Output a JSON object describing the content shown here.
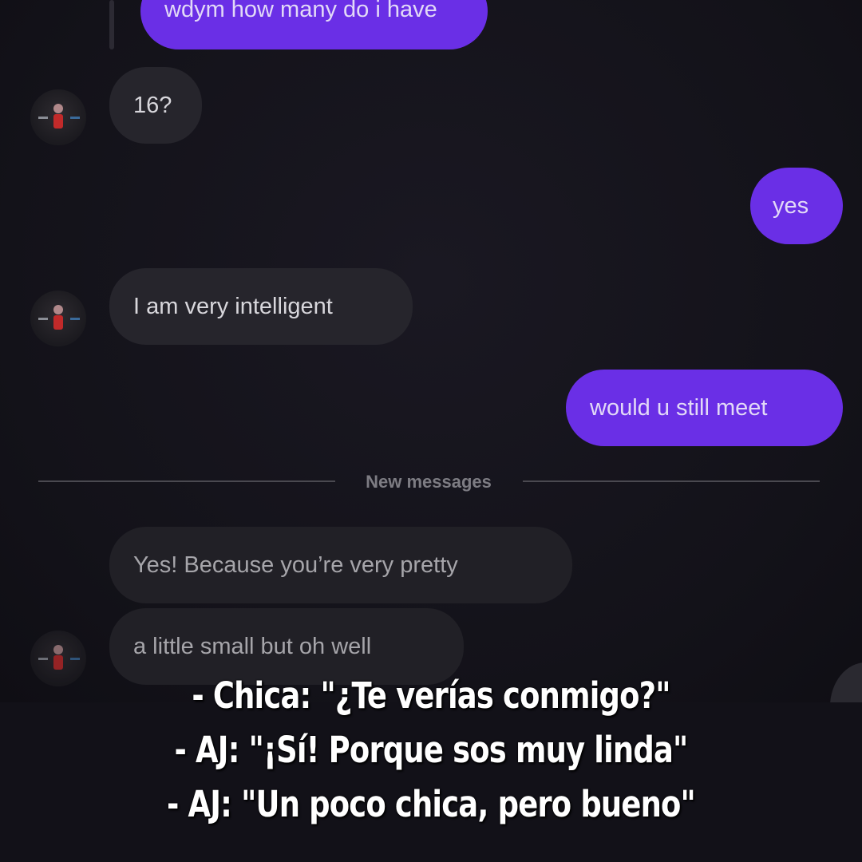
{
  "messages": [
    {
      "sender": "me",
      "text": "wdym how many do i have"
    },
    {
      "sender": "them",
      "text": "16?"
    },
    {
      "sender": "me",
      "text": "yes"
    },
    {
      "sender": "them",
      "text": "I am very intelligent"
    },
    {
      "sender": "me",
      "text": "would u still meet"
    },
    {
      "sender": "them",
      "text": "Yes! Because you’re very pretty"
    },
    {
      "sender": "them",
      "text": "a little small but oh well"
    }
  ],
  "divider": {
    "label": "New messages"
  },
  "caption": [
    "- Chica: \"¿Te verías conmigo?\"",
    "- AJ: \"¡Sí! Porque sos muy linda\"",
    "- AJ: \"Un poco chica, pero bueno\""
  ],
  "icons": {
    "avatar": "contact-avatar-icon"
  },
  "colors": {
    "outgoing_bubble": "#6a2fe6",
    "incoming_bubble": "#26252c",
    "background": "#121118",
    "caption_text": "#ffffff"
  }
}
